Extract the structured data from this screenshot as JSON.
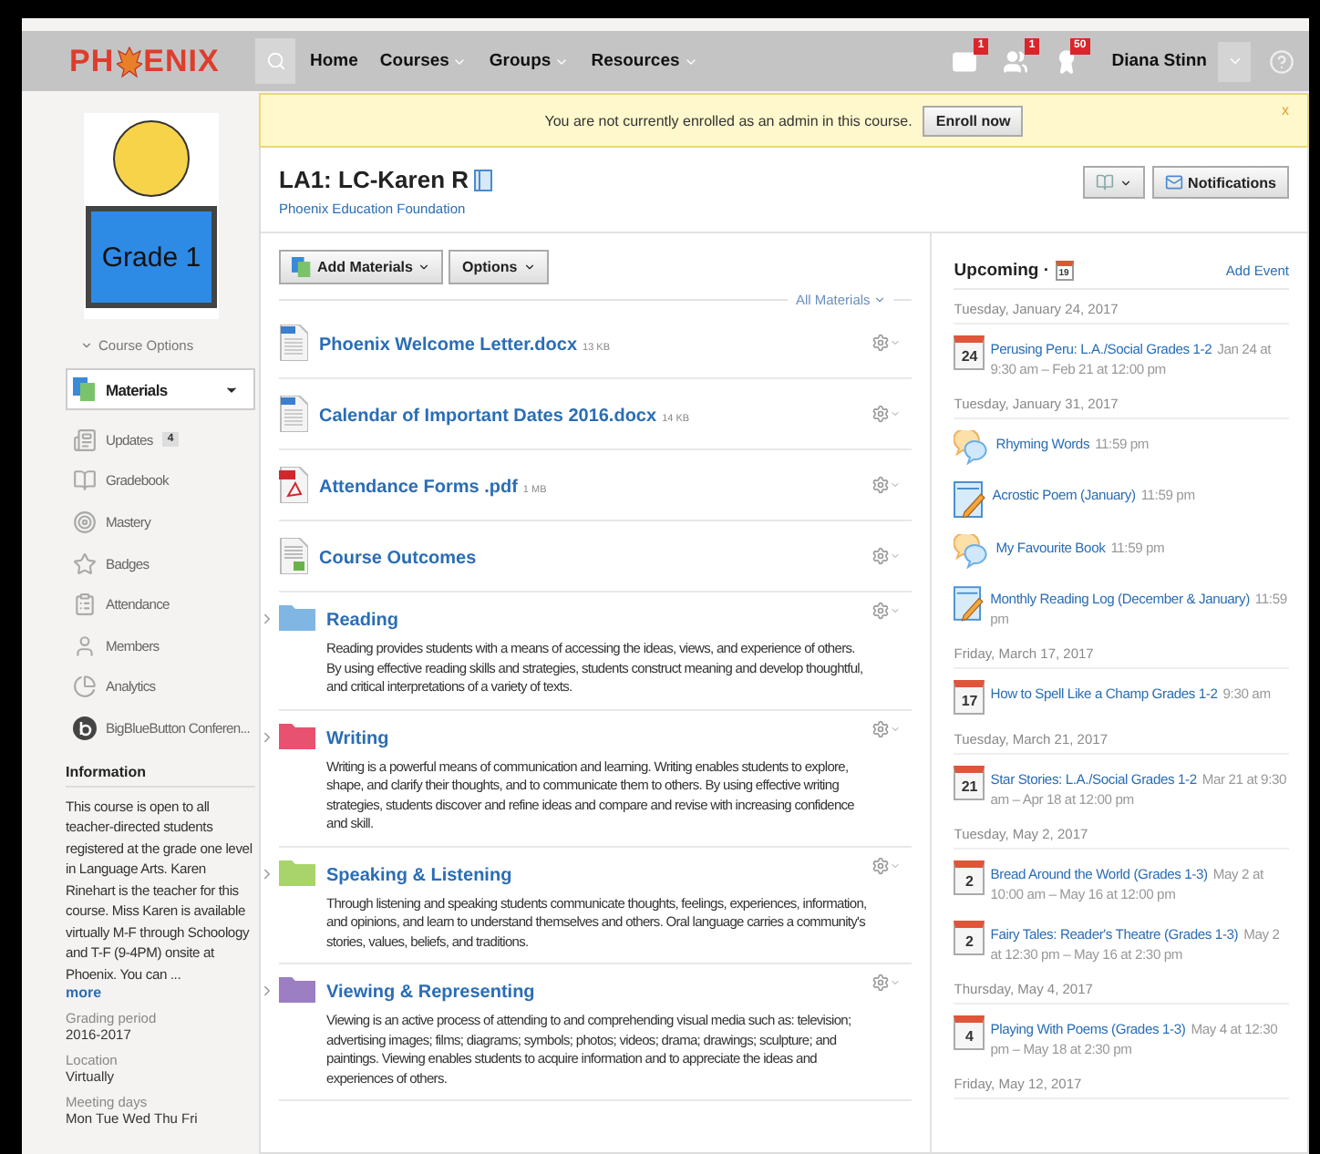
{
  "header": {
    "logo": [
      "PH",
      "ENIX"
    ],
    "nav": [
      {
        "label": "Home",
        "menu": false
      },
      {
        "label": "Courses",
        "menu": true
      },
      {
        "label": "Groups",
        "menu": true
      },
      {
        "label": "Resources",
        "menu": true
      }
    ],
    "alerts": [
      {
        "kind": "mail",
        "count": "1"
      },
      {
        "kind": "requests",
        "count": "1"
      },
      {
        "kind": "badges",
        "count": "50"
      }
    ],
    "user": "Diana Stinn"
  },
  "banner": {
    "text": "You are not currently enrolled as an admin in this course.",
    "button": "Enroll now",
    "close": "x"
  },
  "course": {
    "title": "LA1: LC-Karen R",
    "subtitle": "Phoenix Education Foundation",
    "notifications": "Notifications"
  },
  "sidebar": {
    "image_text": "Grade 1",
    "course_options": "Course Options",
    "items": [
      {
        "label": "Materials",
        "selected": true
      },
      {
        "label": "Updates",
        "selected": false,
        "badge": "4"
      },
      {
        "label": "Gradebook",
        "selected": false
      },
      {
        "label": "Mastery",
        "selected": false
      },
      {
        "label": "Badges",
        "selected": false
      },
      {
        "label": "Attendance",
        "selected": false
      },
      {
        "label": "Members",
        "selected": false
      },
      {
        "label": "Analytics",
        "selected": false
      },
      {
        "label": "BigBlueButton Conferen...",
        "selected": false
      }
    ],
    "info_title": "Information",
    "info_text": "This course is open to all teacher-directed students registered at the grade one level in Language Arts. Karen Rinehart is the teacher for this course. Miss Karen is available virtually M-F through Schoology and T-F (9-4PM) onsite at Phoenix. You can ...",
    "more": "more",
    "fields": [
      {
        "label": "Grading period",
        "value": "2016-2017"
      },
      {
        "label": "Location",
        "value": "Virtually"
      },
      {
        "label": "Meeting days",
        "value": "Mon Tue Wed Thu Fri"
      }
    ]
  },
  "materials": {
    "add": "Add Materials",
    "options": "Options",
    "filter": "All Materials",
    "items": [
      {
        "kind": "word",
        "title": "Phoenix Welcome Letter.docx",
        "size": "13 KB"
      },
      {
        "kind": "word",
        "title": "Calendar of Important Dates 2016.docx",
        "size": "14 KB"
      },
      {
        "kind": "pdf",
        "title": "Attendance Forms .pdf",
        "size": "1 MB"
      },
      {
        "kind": "page",
        "title": "Course Outcomes"
      },
      {
        "kind": "folder",
        "title": "Reading",
        "color": "#7fb6e3",
        "expanded": false,
        "description": "Reading provides students with a means of accessing the ideas, views, and experience of others.  By using effective reading skills and strategies, students construct meaning and develop thoughtful, and critical interpretations of a variety of texts."
      },
      {
        "kind": "folder",
        "title": "Writing",
        "color": "#e8516f",
        "expanded": false,
        "description": "Writing is a powerful means of communication and learning.  Writing enables students to explore, shape, and clarify their thoughts, and to communicate them to others.  By using effective writing strategies, students discover and refine ideas and compare and revise with increasing confidence and skill."
      },
      {
        "kind": "folder",
        "title": "Speaking & Listening",
        "color": "#a9d46b",
        "expanded": false,
        "description": "Through listening and speaking students communicate thoughts, feelings, experiences, information, and opinions, and learn to understand themselves and others.  Oral language carries a community's stories, values, beliefs, and traditions."
      },
      {
        "kind": "folder",
        "title": "Viewing & Representing",
        "color": "#9b7fc2",
        "expanded": false,
        "description": "Viewing is an active process of attending to and comprehending visual media such as:  television; advertising images; films; diagrams; symbols; photos; videos; drama; drawings; sculpture; and paintings.  Viewing enables students to acquire information and to appreciate the ideas and experiences of others."
      }
    ]
  },
  "upcoming": {
    "title": "Upcoming ·",
    "calendar_day": "19",
    "add_event": "Add Event",
    "groups": [
      {
        "date": "Tuesday, January 24, 2017",
        "events": [
          {
            "kind": "event",
            "day": "24",
            "title": "Perusing Peru: L.A./Social Grades 1-2",
            "time": "Jan 24 at 9:30 am – Feb 21 at 12:00 pm"
          }
        ]
      },
      {
        "date": "Tuesday, January 31, 2017",
        "events": [
          {
            "kind": "discussion",
            "title": "Rhyming Words",
            "time": "11:59 pm"
          },
          {
            "kind": "assignment",
            "title": "Acrostic Poem (January)",
            "time": "11:59 pm"
          },
          {
            "kind": "discussion",
            "title": "My Favourite Book",
            "time": "11:59 pm"
          },
          {
            "kind": "assignment",
            "title": "Monthly Reading Log (December & January)",
            "time": "11:59 pm"
          }
        ]
      },
      {
        "date": "Friday, March 17, 2017",
        "events": [
          {
            "kind": "event",
            "day": "17",
            "title": "How to Spell Like a Champ Grades 1-2",
            "time": "9:30 am"
          }
        ]
      },
      {
        "date": "Tuesday, March 21, 2017",
        "events": [
          {
            "kind": "event",
            "day": "21",
            "title": "Star Stories: L.A./Social Grades 1-2",
            "time": "Mar 21 at 9:30 am – Apr 18 at 12:00 pm"
          }
        ]
      },
      {
        "date": "Tuesday, May 2, 2017",
        "events": [
          {
            "kind": "event",
            "day": "2",
            "title": "Bread Around the World (Grades 1-3)",
            "time": "May 2 at 10:00 am – May 16 at 12:00 pm"
          },
          {
            "kind": "event",
            "day": "2",
            "title": "Fairy Tales: Reader's Theatre (Grades 1-3)",
            "time": "May 2 at 12:30 pm – May 16 at 2:30 pm"
          }
        ]
      },
      {
        "date": "Thursday, May 4, 2017",
        "events": [
          {
            "kind": "event",
            "day": "4",
            "title": "Playing With Poems (Grades 1-3)",
            "time": "May 4 at 12:30 pm – May 18 at 2:30 pm"
          }
        ]
      },
      {
        "date": "Friday, May 12, 2017"
      }
    ]
  }
}
